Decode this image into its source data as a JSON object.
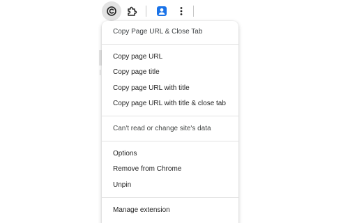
{
  "toolbar": {
    "extension_icon": "copy-c-icon",
    "puzzle_icon": "puzzle-icon",
    "profile_icon": "profile-icon",
    "menu_icon": "kebab-menu-icon"
  },
  "menu": {
    "header": "Copy Page URL & Close Tab",
    "actions": [
      "Copy page URL",
      "Copy page title",
      "Copy page URL with title",
      "Copy page URL with title & close tab"
    ],
    "site_data": "Can't read or change site's data",
    "options": [
      "Options",
      "Remove from Chrome",
      "Unpin"
    ],
    "manage": "Manage extension"
  },
  "colors": {
    "active_button_bg": "#e3e3e3",
    "profile_blue": "#1a73e8",
    "text": "#1f1f1f"
  }
}
